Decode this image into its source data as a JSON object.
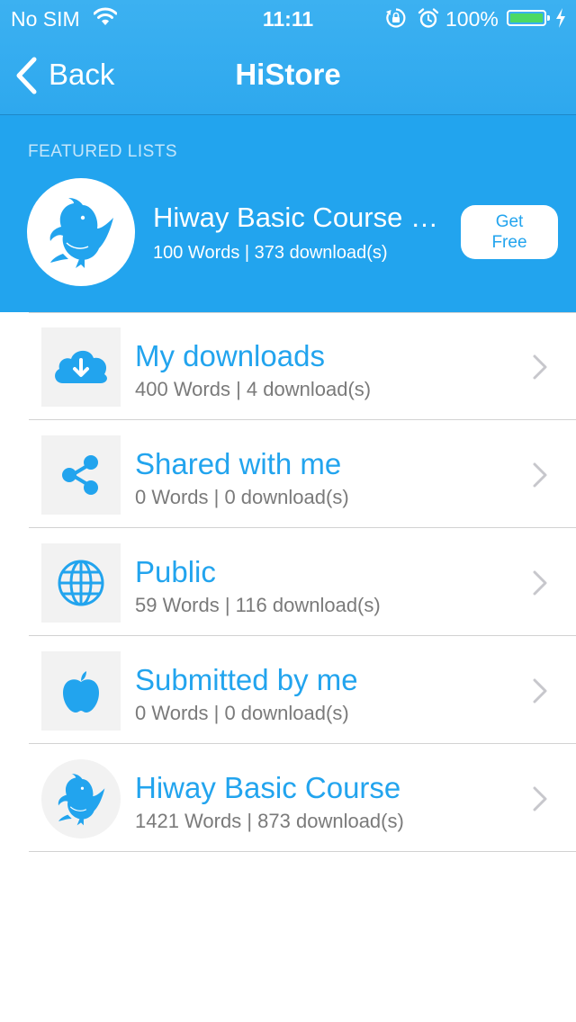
{
  "status_bar": {
    "carrier": "No SIM",
    "time": "11:11",
    "battery": "100%",
    "battery_level": 1.0,
    "icons": [
      "wifi-icon",
      "rotation-lock-icon",
      "alarm-icon",
      "battery-icon",
      "charging-icon"
    ]
  },
  "nav": {
    "back_label": "Back",
    "title": "HiStore"
  },
  "featured": {
    "section_label": "FEATURED LISTS",
    "title": "Hiway Basic Course Eng…",
    "subtitle": "100 Words | 373 download(s)",
    "button_line1": "Get",
    "button_line2": "Free"
  },
  "rows": [
    {
      "title": "My downloads",
      "subtitle": "400 Words | 4 download(s)",
      "icon": "cloud-download-icon"
    },
    {
      "title": "Shared with me",
      "subtitle": "0 Words | 0 download(s)",
      "icon": "share-icon"
    },
    {
      "title": "Public",
      "subtitle": "59 Words | 116 download(s)",
      "icon": "globe-icon"
    },
    {
      "title": "Submitted by me",
      "subtitle": "0 Words | 0 download(s)",
      "icon": "apple-icon"
    },
    {
      "title": "Hiway Basic Course",
      "subtitle": "1421 Words | 873 download(s)",
      "icon": "bird-logo-icon"
    }
  ],
  "colors": {
    "accent": "#22a4ee",
    "nav_bar": "#36adf0",
    "subtitle_gray": "#7a7a7a",
    "battery_green": "#4cd964"
  }
}
